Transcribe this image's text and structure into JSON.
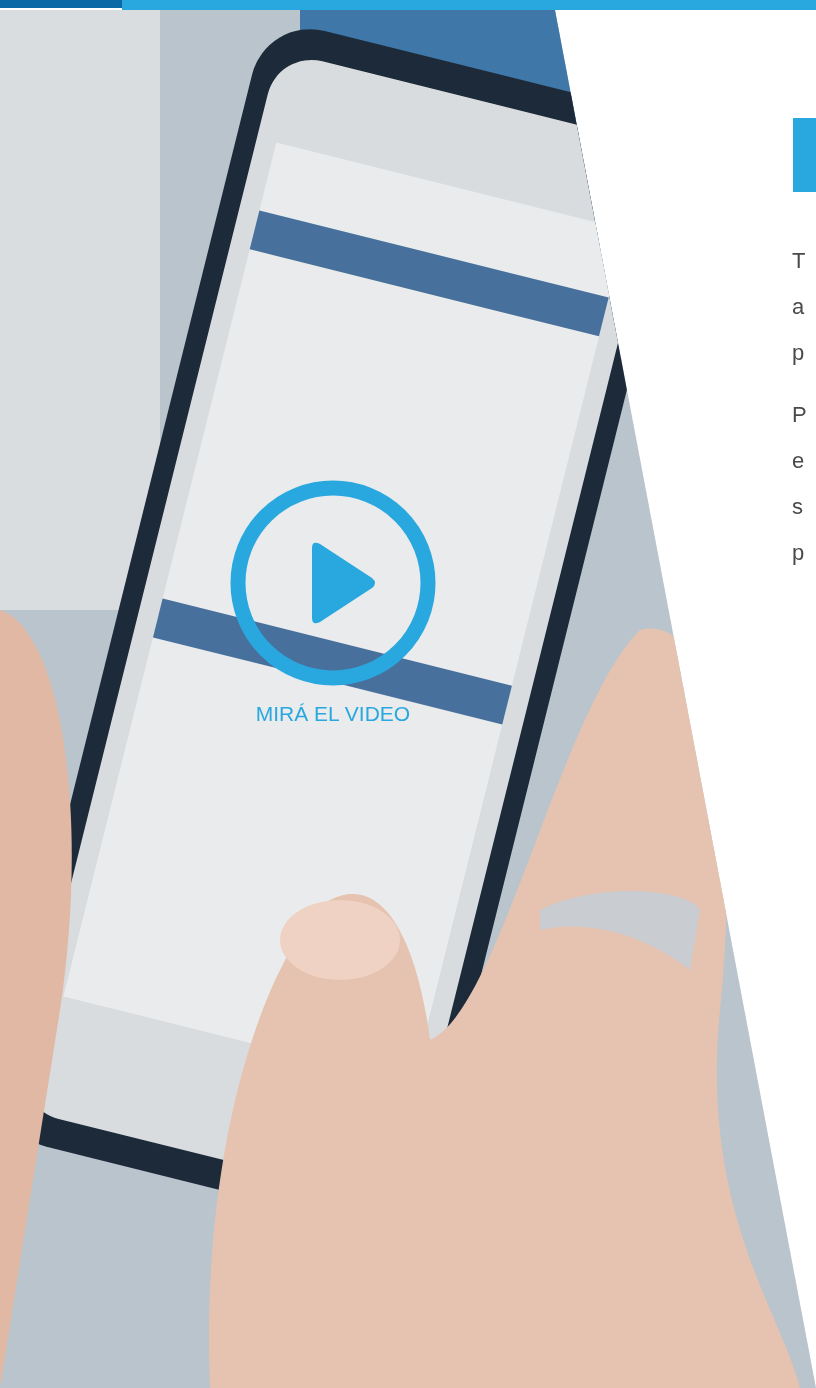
{
  "top_bar": {
    "kind": "split"
  },
  "video_button": {
    "label": "MIRÁ EL VIDEO"
  },
  "side_panel": {
    "paragraphs": [
      {
        "lines": [
          "T",
          "a",
          "p"
        ]
      },
      {
        "lines": [
          "P",
          "e",
          "s",
          "p"
        ]
      }
    ]
  }
}
